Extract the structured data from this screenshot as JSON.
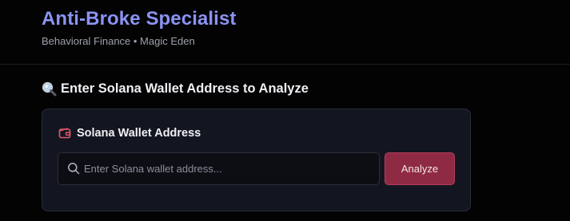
{
  "header": {
    "title": "Anti-Broke Specialist",
    "subtitle": "Behavioral Finance • Magic Eden"
  },
  "section": {
    "heading": "Enter Solana Wallet Address to Analyze",
    "heading_icon": "magnifier-icon"
  },
  "card": {
    "label": "Solana Wallet Address",
    "label_icon": "wallet-icon",
    "search": {
      "placeholder": "Enter Solana wallet address...",
      "value": "",
      "icon": "search-icon"
    },
    "analyze_label": "Analyze"
  },
  "colors": {
    "background": "#030304",
    "title_accent": "#8b93f2",
    "card_bg": "#131620",
    "button_bg": "#8f2a44",
    "wallet_icon": "#e2576f"
  }
}
